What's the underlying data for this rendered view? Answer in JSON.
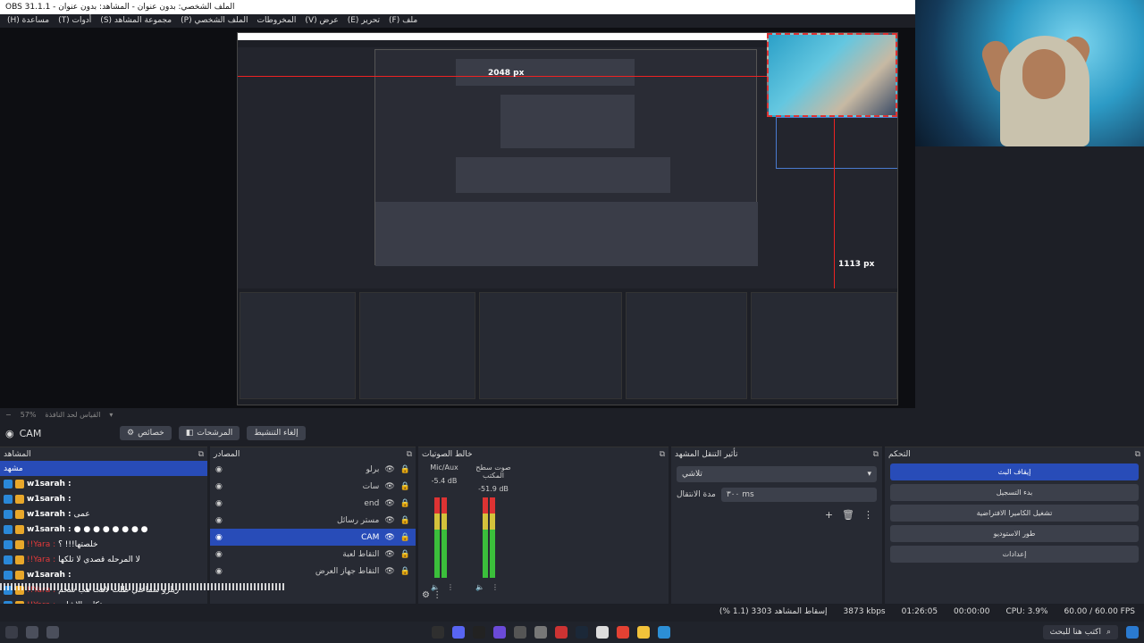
{
  "window": {
    "title": "OBS 31.1.1 - الملف الشخصي: بدون عنوان - المشاهد: بدون عنوان"
  },
  "menu": [
    "ملف (F)",
    "تحرير (E)",
    "عرض (V)",
    "المخروطات",
    "الملف الشخصي (P)",
    "مجموعة المشاهد (S)",
    "أدوات (T)",
    "مساعدة (H)"
  ],
  "preview": {
    "measure_top": "2048 px",
    "measure_right": "1113 px",
    "measure_small": "1113 px"
  },
  "zoom": {
    "level": "57%",
    "scale_label": "القياس لحد النافذة"
  },
  "toolbar": {
    "source_name": "CAM",
    "props_label": "خصائص",
    "filters_label": "المرشحات",
    "deactivate_label": "إلغاء التنشيط"
  },
  "scenes": {
    "title": "المشاهد",
    "items": [
      {
        "type": "label",
        "text": "مشهد"
      },
      {
        "user": "w1sarah :",
        "text": "",
        "red": false
      },
      {
        "user": "w1sarah :",
        "text": "",
        "red": false
      },
      {
        "user": "w1sarah :",
        "text": "عمى",
        "red": false
      },
      {
        "user": "w1sarah :",
        "text": "● ● ● ● ● ● ● ●",
        "red": false
      },
      {
        "user": "!!Yara :",
        "text": "خلصتها!!! ؟",
        "red": true
      },
      {
        "user": "!!Yara :",
        "text": "لا المرحله قصدي لا تلكها",
        "red": true
      },
      {
        "user": "w1sarah :",
        "text": "",
        "red": false
      },
      {
        "user": "!!Yara :",
        "text": "ريلزو سماعتي طلت لاهت هب شحم",
        "red": true
      },
      {
        "user": "!!Yara :",
        "text": "تكلم بالإشاره",
        "red": true
      }
    ]
  },
  "sources": {
    "title": "المصادر",
    "items": [
      {
        "name": "برلو",
        "selected": false
      },
      {
        "name": "سات",
        "selected": false
      },
      {
        "name": "end",
        "selected": false
      },
      {
        "name": "مستر رسائل",
        "selected": false
      },
      {
        "name": "CAM",
        "selected": true
      },
      {
        "name": "التقاط لعبة",
        "selected": false
      },
      {
        "name": "التقاط جهاز العرض",
        "selected": false
      }
    ]
  },
  "mixer": {
    "title": "خالط الصوتيات",
    "channels": [
      {
        "name": "Mic/Aux",
        "db": "-5.4 dB"
      },
      {
        "name": "صوت سطح المكتب",
        "db": "-51.9 dB"
      }
    ],
    "scale": [
      "0",
      "-5",
      "-10",
      "-15",
      "-20",
      "-25",
      "-30",
      "-35",
      "-40",
      "-45",
      "-50",
      "-55",
      "-60"
    ]
  },
  "transitions": {
    "title": "تأثير التنقل المشهد",
    "selected": "تلاشي",
    "duration_label": "مدة الانتقال",
    "duration_value": "٣٠٠ ms"
  },
  "controls": {
    "title": "التحكم",
    "buttons": [
      "إيقاف البث",
      "بدء التسجيل",
      "تشغيل الكاميرا الافتراضية",
      "طور الاستوديو",
      "إعدادات"
    ]
  },
  "status": {
    "dropped": "إسقاط المشاهد 3303 (1.1 %)",
    "bitrate": "3873 kbps",
    "stream_time": "01:26:05",
    "rec_time": "00:00:00",
    "cpu": "CPU: 3.9%",
    "fps": "60.00 / 60.00 FPS"
  },
  "taskbar": {
    "search_placeholder": "اكتب هنا للبحث"
  }
}
